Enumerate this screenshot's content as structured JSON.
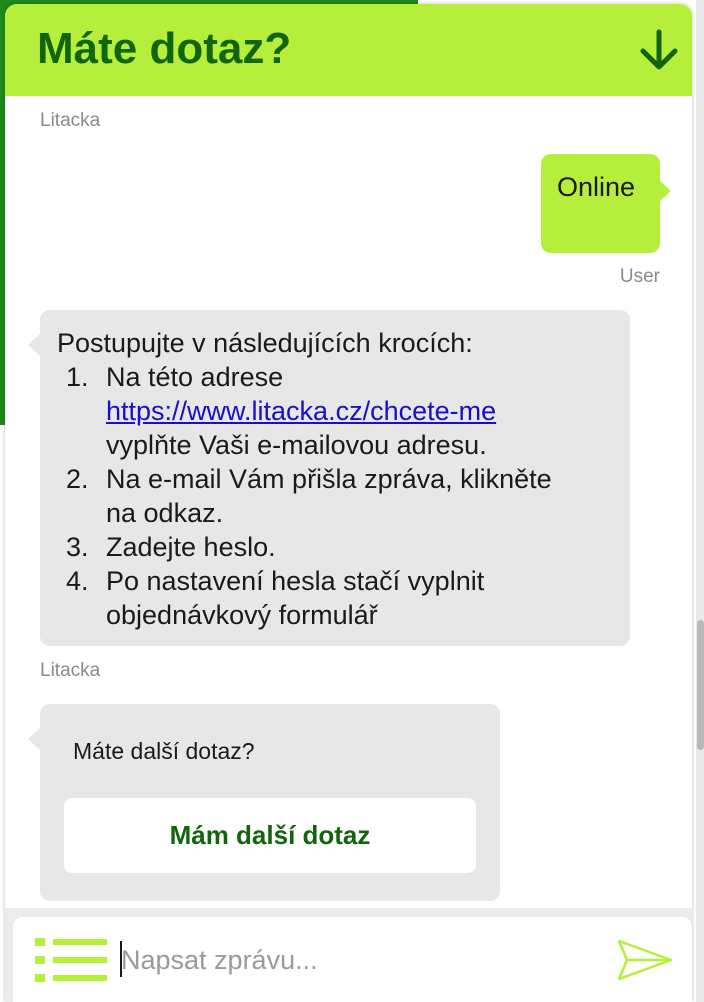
{
  "header": {
    "title": "Máte dotaz?"
  },
  "messages": [
    {
      "sender": "Litacka"
    },
    {
      "sender": "User",
      "text": "Online"
    },
    {
      "sender": "Litacka",
      "intro": "Postupujte v následujících krocích:",
      "steps": [
        {
          "number": "1.",
          "line1": "Na této adrese",
          "link": "https://www.litacka.cz/chcete-me",
          "line3": "vyplňte Vaši e-mailovou adresu."
        },
        {
          "number": "2.",
          "line1": "Na e-mail Vám přišla zpráva, klikněte",
          "line2": "na odkaz."
        },
        {
          "number": "3.",
          "line1": "Zadejte heslo."
        },
        {
          "number": "4.",
          "line1": "Po nastavení hesla stačí vyplnit",
          "line2": "objednávkový formulář"
        }
      ]
    },
    {
      "sender": "Litacka",
      "question": "Máte další dotaz?",
      "button_label": "Mám další dotaz"
    }
  ],
  "composer": {
    "placeholder": "Napsat zprávu..."
  },
  "icons": {
    "minimize": "arrow-down-icon",
    "menu": "list-menu-icon",
    "send": "paper-plane-send-icon"
  },
  "colors": {
    "header_bg": "#b6ef3b",
    "brand_green": "#11660d",
    "user_bubble": "#b6ef3b",
    "bot_bubble": "#e7e7e7",
    "link": "#1a0dcc",
    "page_green": "#1f8a1a"
  }
}
